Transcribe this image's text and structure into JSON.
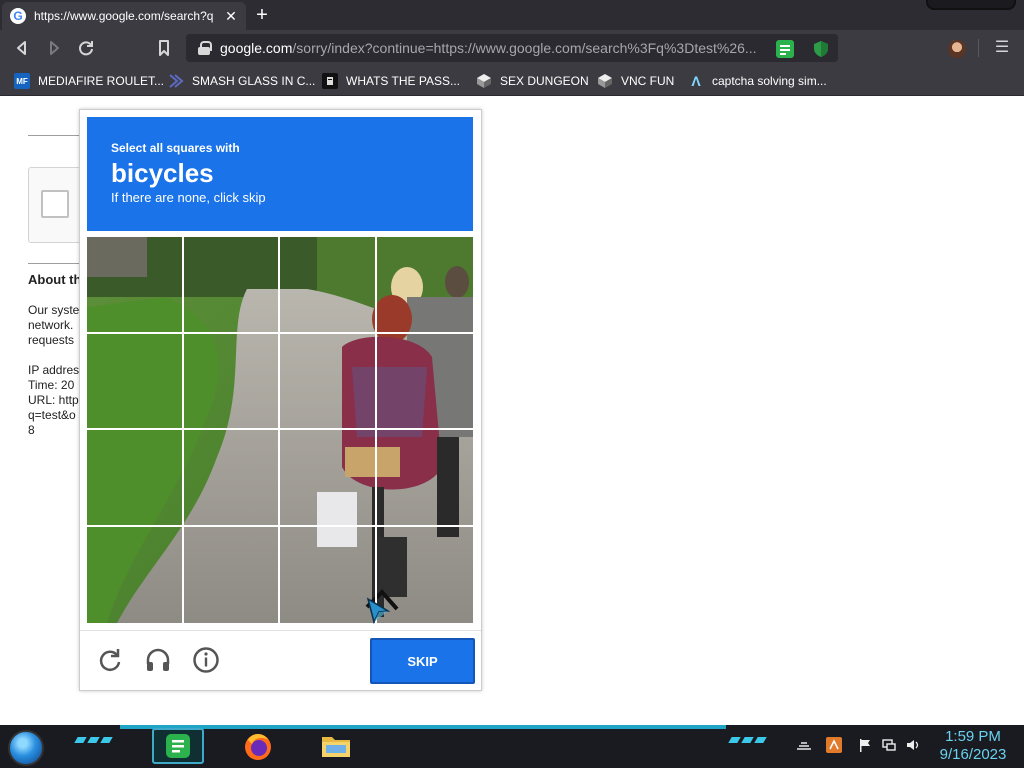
{
  "browser": {
    "tab": {
      "favicon": "G",
      "title": "https://www.google.com/search?q",
      "close": "✕"
    },
    "new_tab": "+",
    "nav": {
      "back": "back-icon",
      "forward": "forward-icon",
      "reload": "reload-icon",
      "bookmark": "bookmark-icon"
    },
    "url": {
      "host": "google.com",
      "rest": "/sorry/index?continue=https://www.google.com/search%3Fq%3Dtest%26..."
    },
    "menu": "☰"
  },
  "bookmarks": [
    {
      "label": "MEDIAFIRE ROULET...",
      "icon": "MF",
      "color": "#1565c0"
    },
    {
      "label": "SMASH GLASS IN C...",
      "icon": "",
      "color": "#3949ab"
    },
    {
      "label": "WHATS THE PASS...",
      "icon": "",
      "color": "#111111"
    },
    {
      "label": "SEX DUNGEON",
      "icon": "",
      "color": "#cfcfcf"
    },
    {
      "label": "VNC FUN",
      "icon": "",
      "color": "#cfcfcf"
    },
    {
      "label": "captcha solving sim...",
      "icon": "Λ",
      "color": "#3d3b42"
    }
  ],
  "page": {
    "heading": "About th",
    "lines": [
      "Our syste",
      "network.",
      "requests",
      "",
      "IP addres",
      "Time: 20",
      "URL: http",
      "q=test&o",
      "8"
    ]
  },
  "captcha": {
    "instruction": "Select all squares with",
    "target": "bicycles",
    "subtext": "If there are none, click skip",
    "grid_rows": 4,
    "grid_cols": 4,
    "footer_icons": [
      "reload-icon",
      "headphones-icon",
      "info-icon"
    ],
    "skip_label": "SKIP",
    "colors": {
      "header": "#1a73e8",
      "button": "#1a73e8"
    }
  },
  "taskbar": {
    "apps": [
      "notes-app-icon",
      "firefox-icon",
      "file-explorer-icon"
    ],
    "tray": [
      "sound-app-icon",
      "flag-icon",
      "network-icon",
      "volume-icon"
    ],
    "time": "1:59 PM",
    "date": "9/16/2023",
    "accent": "#1fa3c6"
  }
}
